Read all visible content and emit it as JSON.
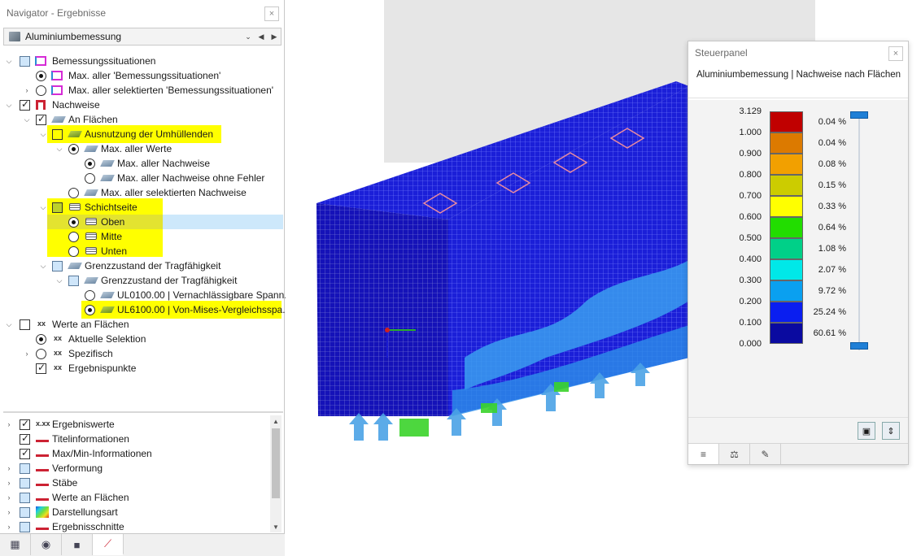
{
  "navigator": {
    "title": "Navigator - Ergebnisse",
    "close": "×",
    "combo": {
      "value": "Aluminiumbemessung",
      "dropdown": "⌄",
      "prev": "◀",
      "next": "▶"
    },
    "tree": [
      {
        "label": "Bemessungssituationen"
      },
      {
        "label": "Max. aller 'Bemessungssituationen'"
      },
      {
        "label": "Max. aller selektierten 'Bemessungssituationen'"
      },
      {
        "label": "Nachweise"
      },
      {
        "label": "An Flächen"
      },
      {
        "label": "Ausnutzung der Umhüllenden"
      },
      {
        "label": "Max. aller Werte"
      },
      {
        "label": "Max. aller Nachweise"
      },
      {
        "label": "Max. aller Nachweise ohne Fehler"
      },
      {
        "label": "Max. aller selektierten Nachweise"
      },
      {
        "label": "Schichtseite"
      },
      {
        "label": "Oben"
      },
      {
        "label": "Mitte"
      },
      {
        "label": "Unten"
      },
      {
        "label": "Grenzzustand der Tragfähigkeit"
      },
      {
        "label": "Grenzzustand der Tragfähigkeit"
      },
      {
        "label": "UL0100.00 | Vernachlässigbare Spann..."
      },
      {
        "label": "UL6100.00 | Von-Mises-Vergleichsspa..."
      },
      {
        "label": "Werte an Flächen"
      },
      {
        "label": "Aktuelle Selektion"
      },
      {
        "label": "Spezifisch"
      },
      {
        "label": "Ergebnispunkte"
      }
    ],
    "bottom_tree": [
      {
        "label": "Ergebniswerte"
      },
      {
        "label": "Titelinformationen"
      },
      {
        "label": "Max/Min-Informationen"
      },
      {
        "label": "Verformung"
      },
      {
        "label": "Stäbe"
      },
      {
        "label": "Werte an Flächen"
      },
      {
        "label": "Darstellungsart"
      },
      {
        "label": "Ergebnisschnitte"
      }
    ],
    "icon_xxx": "x.xx",
    "icon_xx": "xx"
  },
  "panel": {
    "title": "Steuerpanel",
    "close": "×",
    "subtitle": "Aluminiumbemessung | Nachweise nach Flächen",
    "legend": [
      {
        "value": "3.129",
        "color": "#c00000",
        "percent": "0.04 %"
      },
      {
        "value": "1.000",
        "color": "#dc7a00",
        "percent": "0.04 %"
      },
      {
        "value": "0.900",
        "color": "#f2a000",
        "percent": "0.08 %"
      },
      {
        "value": "0.800",
        "color": "#cccc00",
        "percent": "0.15 %"
      },
      {
        "value": "0.700",
        "color": "#ffff00",
        "percent": "0.33 %"
      },
      {
        "value": "0.600",
        "color": "#22dd00",
        "percent": "0.64 %"
      },
      {
        "value": "0.500",
        "color": "#00d088",
        "percent": "1.08 %"
      },
      {
        "value": "0.400",
        "color": "#00e8e8",
        "percent": "2.07 %"
      },
      {
        "value": "0.300",
        "color": "#0aa0f0",
        "percent": "9.72 %"
      },
      {
        "value": "0.200",
        "color": "#0a1ef0",
        "percent": "25.24 %"
      },
      {
        "value": "0.100",
        "color": "#0a0aa0",
        "percent": "60.61 %"
      },
      {
        "value": "0.000",
        "color": null,
        "percent": null
      }
    ]
  }
}
